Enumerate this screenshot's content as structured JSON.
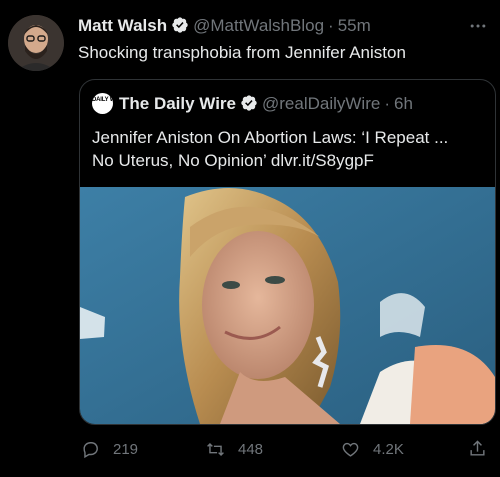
{
  "tweet": {
    "author_name": "Matt Walsh",
    "handle": "@MattWalshBlog",
    "separator": "·",
    "time": "55m",
    "text": "Shocking transphobia from Jennifer Aniston",
    "more_icon": "more-icon"
  },
  "quote": {
    "logo_text": "DAILY WIRE",
    "author_name": "The Daily Wire",
    "handle": "@realDailyWire",
    "separator": "·",
    "time": "6h",
    "text_line1": "Jennifer Aniston On Abortion Laws: ‘I Repeat ...",
    "text_line2": "No Uterus, No Opinion’ dlvr.it/S8ygpF"
  },
  "actions": {
    "replies": "219",
    "retweets": "448",
    "likes": "4.2K"
  },
  "colors": {
    "background": "#000000",
    "text": "#e7e9ea",
    "muted": "#71767b",
    "verified": "#1d9bf0"
  }
}
